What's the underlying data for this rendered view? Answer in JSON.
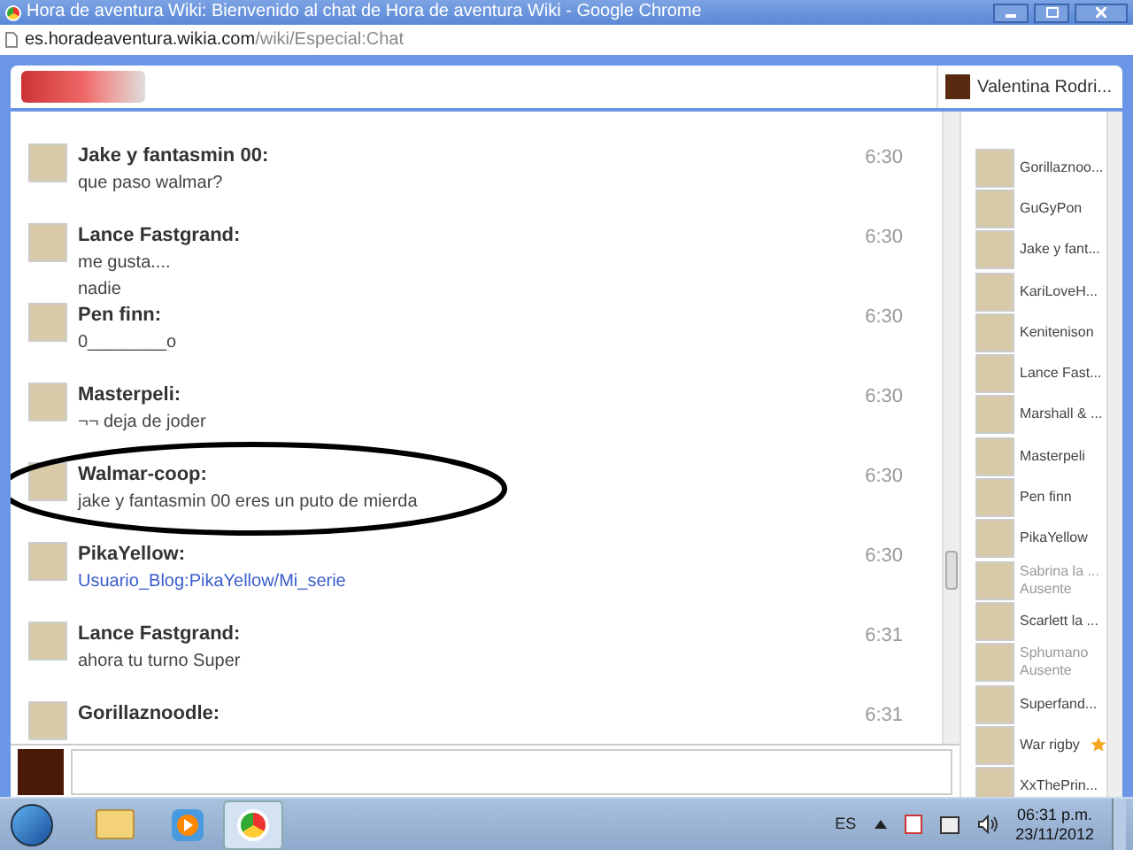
{
  "window": {
    "title": "Hora de aventura Wiki: Bienvenido al chat de Hora de aventura Wiki - Google Chrome"
  },
  "address_bar": {
    "domain": "es.horadeaventura.wikia.com",
    "path": "/wiki/Especial:Chat"
  },
  "header": {
    "current_user": "Valentina Rodri..."
  },
  "messages": [
    {
      "author": "Jake y fantasmin 00:",
      "lines": [
        "que paso walmar?"
      ],
      "time": "6:30",
      "kind": "text",
      "circled": false
    },
    {
      "author": "Lance Fastgrand:",
      "lines": [
        "me gusta....",
        "nadie"
      ],
      "time": "6:30",
      "kind": "text",
      "circled": false
    },
    {
      "author": "Pen finn:",
      "lines": [
        "0________o"
      ],
      "time": "6:30",
      "kind": "text",
      "circled": false
    },
    {
      "author": "Masterpeli:",
      "lines": [
        "¬¬ deja de joder"
      ],
      "time": "6:30",
      "kind": "text",
      "circled": false
    },
    {
      "author": "Walmar-coop:",
      "lines": [
        "jake y fantasmin 00 eres un puto de mierda"
      ],
      "time": "6:30",
      "kind": "text",
      "circled": true
    },
    {
      "author": "PikaYellow:",
      "lines": [
        "Usuario_Blog:PikaYellow/Mi_serie"
      ],
      "time": "6:30",
      "kind": "link",
      "circled": false
    },
    {
      "author": "Lance Fastgrand:",
      "lines": [
        "ahora tu turno Super"
      ],
      "time": "6:31",
      "kind": "text",
      "circled": false
    },
    {
      "author": "Gorillaznoodle:",
      "time": "6:31",
      "circled": false
    }
  ],
  "users": [
    {
      "name": "Gorillaznoo...",
      "away": false,
      "starred": false
    },
    {
      "name": "GuGyPon",
      "away": false,
      "starred": false
    },
    {
      "name": "Jake y fant...",
      "away": false,
      "starred": false
    },
    {
      "name": "KariLoveH...",
      "away": false,
      "starred": false
    },
    {
      "name": "Kenitenison",
      "away": false,
      "starred": false
    },
    {
      "name": "Lance Fast...",
      "away": false,
      "starred": false
    },
    {
      "name": "Marshall & ...",
      "away": false,
      "starred": false
    },
    {
      "name": "Masterpeli",
      "away": false,
      "starred": false
    },
    {
      "name": "Pen finn",
      "away": false,
      "starred": false
    },
    {
      "name": "PikaYellow",
      "away": false,
      "starred": false
    },
    {
      "name": "Sabrina la ...",
      "away": true,
      "status": "Ausente",
      "starred": false
    },
    {
      "name": "Scarlett la ...",
      "away": false,
      "starred": false
    },
    {
      "name": "Sphumano",
      "away": true,
      "status": "Ausente",
      "starred": false
    },
    {
      "name": "Superfand...",
      "away": false,
      "starred": false
    },
    {
      "name": "War rigby",
      "away": false,
      "starred": true
    },
    {
      "name": "XxThePrin...",
      "away": false,
      "starred": false
    }
  ],
  "taskbar": {
    "language": "ES",
    "time": "06:31 p.m.",
    "date": "23/11/2012"
  }
}
